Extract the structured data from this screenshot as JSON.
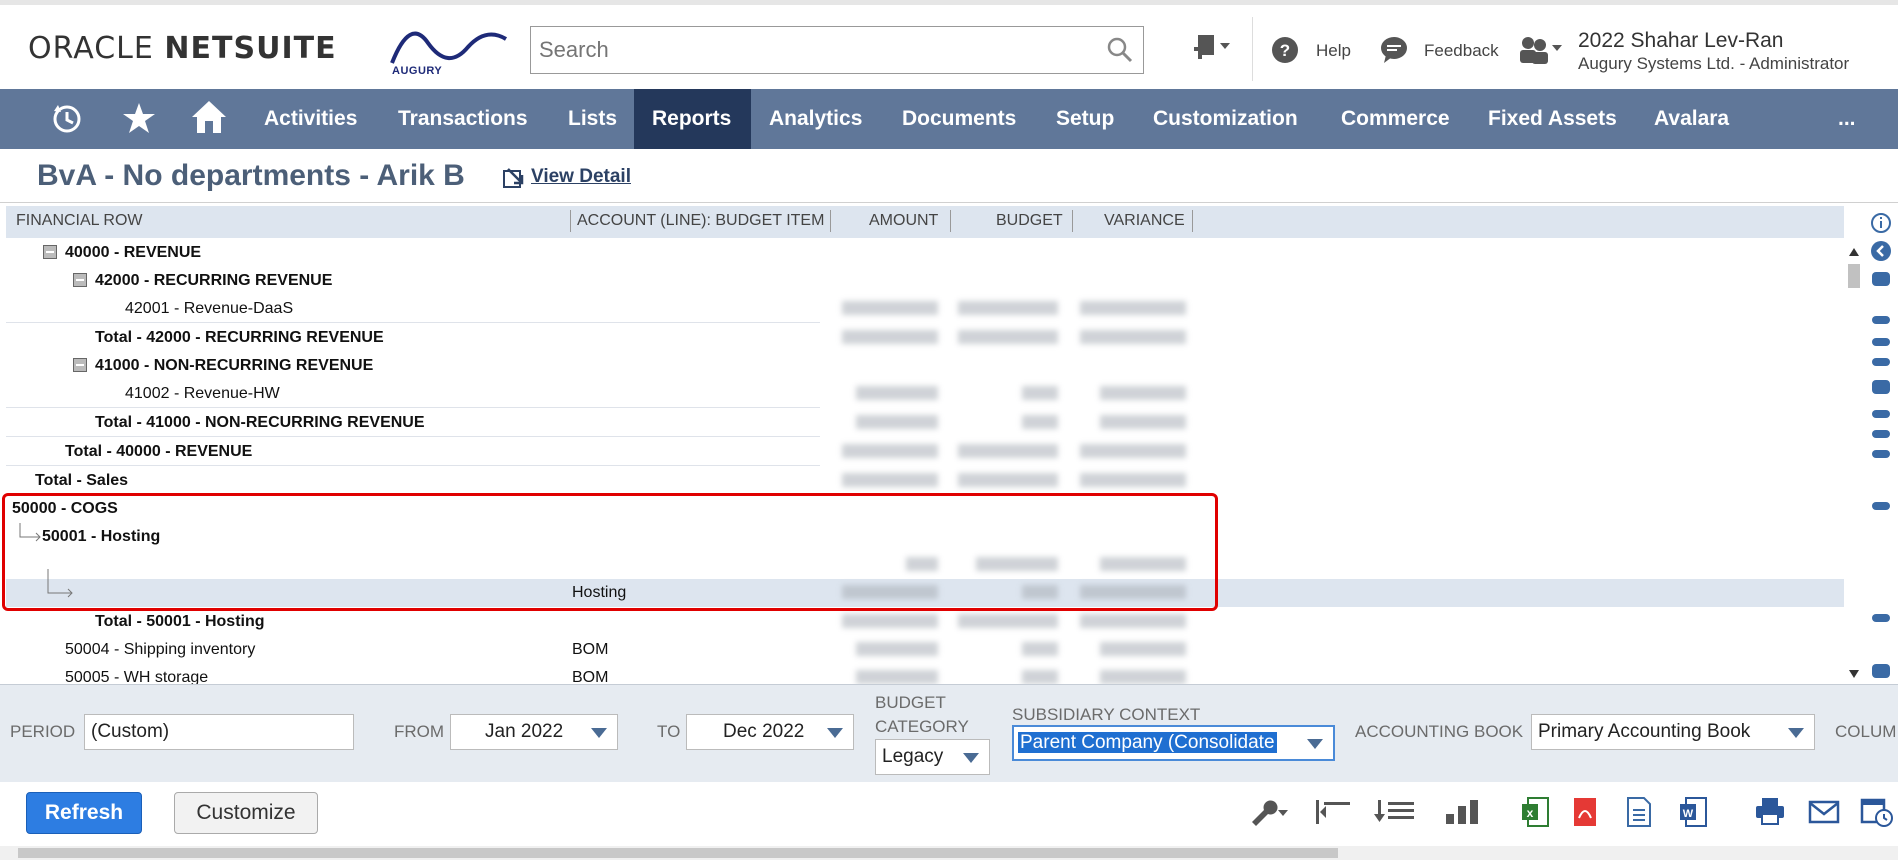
{
  "header": {
    "oracle_logo": "ORACLE",
    "netsuite_logo": "NETSUITE",
    "company_logo": "AUGURY",
    "search_placeholder": "Search",
    "help_label": "Help",
    "feedback_label": "Feedback",
    "user_name": "2022 Shahar Lev-Ran",
    "user_role": "Augury Systems Ltd. - Administrator"
  },
  "nav": {
    "items": [
      "Activities",
      "Transactions",
      "Lists",
      "Reports",
      "Analytics",
      "Documents",
      "Setup",
      "Customization",
      "Commerce",
      "Fixed Assets",
      "Avalara"
    ],
    "active": "Reports",
    "more": "..."
  },
  "page": {
    "title": "BvA - No departments - Arik B",
    "view_detail": "View Detail"
  },
  "columns": {
    "financial_row": "FINANCIAL ROW",
    "account": "ACCOUNT (LINE): BUDGET ITEM",
    "amount": "AMOUNT",
    "budget": "BUDGET",
    "variance": "VARIANCE"
  },
  "rows": [
    {
      "label": "40000 - REVENUE",
      "account": ""
    },
    {
      "label": "42000 - RECURRING REVENUE",
      "account": ""
    },
    {
      "label": "42001 - Revenue-DaaS",
      "account": ""
    },
    {
      "label": "Total - 42000 - RECURRING REVENUE",
      "account": ""
    },
    {
      "label": "41000 - NON-RECURRING REVENUE",
      "account": ""
    },
    {
      "label": "41002 - Revenue-HW",
      "account": ""
    },
    {
      "label": "Total - 41000 - NON-RECURRING REVENUE",
      "account": ""
    },
    {
      "label": "Total - 40000 - REVENUE",
      "account": ""
    },
    {
      "label": "Total - Sales",
      "account": ""
    },
    {
      "label": "50000 - COGS",
      "account": ""
    },
    {
      "label": "50001 - Hosting",
      "account": ""
    },
    {
      "label": "",
      "account": ""
    },
    {
      "label": "",
      "account": "Hosting"
    },
    {
      "label": "Total - 50001 - Hosting",
      "account": ""
    },
    {
      "label": "50004 - Shipping inventory",
      "account": "BOM"
    },
    {
      "label": "50005 - WH storage",
      "account": "BOM"
    }
  ],
  "filters": {
    "period_label": "PERIOD",
    "period_value": "(Custom)",
    "from_label": "FROM",
    "from_value": "Jan 2022",
    "to_label": "TO",
    "to_value": "Dec 2022",
    "budget_category_label_1": "BUDGET",
    "budget_category_label_2": "CATEGORY",
    "budget_category_value": "Legacy",
    "subsidiary_label": "SUBSIDIARY CONTEXT",
    "subsidiary_value": "Parent Company (Consolidate",
    "accounting_book_label": "ACCOUNTING BOOK",
    "accounting_book_value": "Primary Accounting Book",
    "column_label": "COLUM"
  },
  "buttons": {
    "refresh": "Refresh",
    "customize": "Customize"
  },
  "colors": {
    "nav_bg": "#607799",
    "nav_active": "#24385b",
    "primary_button": "#2d7de2",
    "highlight_box": "#e00000"
  }
}
